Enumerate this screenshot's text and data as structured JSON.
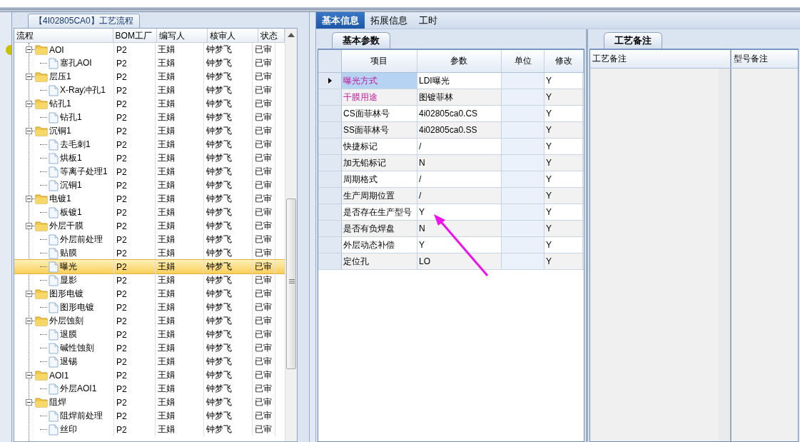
{
  "flow_panel": {
    "title": "【4I02805CA0】工艺流程",
    "columns": [
      "流程",
      "BOM工厂",
      "编写人",
      "核审人",
      "状态"
    ],
    "tree": [
      {
        "name": "AOI",
        "bom": "P2",
        "writer": "王娟",
        "reviewer": "钟梦飞",
        "status": "已审",
        "selected": false,
        "expanded": true,
        "children": [
          {
            "name": "塞孔AOI",
            "bom": "P2",
            "writer": "王娟",
            "reviewer": "钟梦飞",
            "status": "已审",
            "selected": false
          }
        ]
      },
      {
        "name": "层压1",
        "bom": "P2",
        "writer": "王娟",
        "reviewer": "钟梦飞",
        "status": "已审",
        "selected": false,
        "expanded": true,
        "children": [
          {
            "name": "X-Ray冲孔1",
            "bom": "P2",
            "writer": "王娟",
            "reviewer": "钟梦飞",
            "status": "已审",
            "selected": false
          }
        ]
      },
      {
        "name": "钻孔1",
        "bom": "P2",
        "writer": "王娟",
        "reviewer": "钟梦飞",
        "status": "已审",
        "selected": false,
        "expanded": true,
        "children": [
          {
            "name": "钻孔1",
            "bom": "P2",
            "writer": "王娟",
            "reviewer": "钟梦飞",
            "status": "已审",
            "selected": false
          }
        ]
      },
      {
        "name": "沉铜1",
        "bom": "P2",
        "writer": "王娟",
        "reviewer": "钟梦飞",
        "status": "已审",
        "selected": false,
        "expanded": true,
        "children": [
          {
            "name": "去毛刺1",
            "bom": "P2",
            "writer": "王娟",
            "reviewer": "钟梦飞",
            "status": "已审",
            "selected": false
          },
          {
            "name": "烘板1",
            "bom": "P2",
            "writer": "王娟",
            "reviewer": "钟梦飞",
            "status": "已审",
            "selected": false
          },
          {
            "name": "等离子处理1",
            "bom": "P2",
            "writer": "王娟",
            "reviewer": "钟梦飞",
            "status": "已审",
            "selected": false
          },
          {
            "name": "沉铜1",
            "bom": "P2",
            "writer": "王娟",
            "reviewer": "钟梦飞",
            "status": "已审",
            "selected": false
          }
        ]
      },
      {
        "name": "电镀1",
        "bom": "P2",
        "writer": "王娟",
        "reviewer": "钟梦飞",
        "status": "已审",
        "selected": false,
        "expanded": true,
        "children": [
          {
            "name": "板镀1",
            "bom": "P2",
            "writer": "王娟",
            "reviewer": "钟梦飞",
            "status": "已审",
            "selected": false
          }
        ]
      },
      {
        "name": "外层干膜",
        "bom": "P2",
        "writer": "王娟",
        "reviewer": "钟梦飞",
        "status": "已审",
        "selected": false,
        "expanded": true,
        "children": [
          {
            "name": "外层前处理",
            "bom": "P2",
            "writer": "王娟",
            "reviewer": "钟梦飞",
            "status": "已审",
            "selected": false
          },
          {
            "name": "贴膜",
            "bom": "P2",
            "writer": "王娟",
            "reviewer": "钟梦飞",
            "status": "已审",
            "selected": false
          },
          {
            "name": "曝光",
            "bom": "P2",
            "writer": "王娟",
            "reviewer": "钟梦飞",
            "status": "已审",
            "selected": true
          },
          {
            "name": "显影",
            "bom": "P2",
            "writer": "王娟",
            "reviewer": "钟梦飞",
            "status": "已审",
            "selected": false
          }
        ]
      },
      {
        "name": "图形电镀",
        "bom": "P2",
        "writer": "王娟",
        "reviewer": "钟梦飞",
        "status": "已审",
        "selected": false,
        "expanded": true,
        "children": [
          {
            "name": "图形电镀",
            "bom": "P2",
            "writer": "王娟",
            "reviewer": "钟梦飞",
            "status": "已审",
            "selected": false
          }
        ]
      },
      {
        "name": "外层蚀刻",
        "bom": "P2",
        "writer": "王娟",
        "reviewer": "钟梦飞",
        "status": "已审",
        "selected": false,
        "expanded": true,
        "children": [
          {
            "name": "退膜",
            "bom": "P2",
            "writer": "王娟",
            "reviewer": "钟梦飞",
            "status": "已审",
            "selected": false
          },
          {
            "name": "碱性蚀刻",
            "bom": "P2",
            "writer": "王娟",
            "reviewer": "钟梦飞",
            "status": "已审",
            "selected": false
          },
          {
            "name": "退锡",
            "bom": "P2",
            "writer": "王娟",
            "reviewer": "钟梦飞",
            "status": "已审",
            "selected": false
          }
        ]
      },
      {
        "name": "AOI1",
        "bom": "P2",
        "writer": "王娟",
        "reviewer": "钟梦飞",
        "status": "已审",
        "selected": false,
        "expanded": true,
        "children": [
          {
            "name": "外层AOI1",
            "bom": "P2",
            "writer": "王娟",
            "reviewer": "钟梦飞",
            "status": "已审",
            "selected": false
          }
        ]
      },
      {
        "name": "阻焊",
        "bom": "P2",
        "writer": "王娟",
        "reviewer": "钟梦飞",
        "status": "已审",
        "selected": false,
        "expanded": true,
        "children": [
          {
            "name": "阻焊前处理",
            "bom": "P2",
            "writer": "王娟",
            "reviewer": "钟梦飞",
            "status": "已审",
            "selected": false
          },
          {
            "name": "丝印",
            "bom": "P2",
            "writer": "王娟",
            "reviewer": "钟梦飞",
            "status": "已审",
            "selected": false
          }
        ]
      }
    ]
  },
  "tabs": [
    {
      "label": "基本信息",
      "selected": true
    },
    {
      "label": "拓展信息",
      "selected": false
    },
    {
      "label": "工时",
      "selected": false
    }
  ],
  "params_panel": {
    "tab": "基本参数",
    "columns": [
      "项目",
      "参数",
      "单位",
      "修改"
    ],
    "rows": [
      {
        "item": "曝光方式",
        "value": "LDI曝光",
        "modify": "Y",
        "highlighted": true,
        "selected": true
      },
      {
        "item": "干膜用途",
        "value": "图镀菲林",
        "modify": "Y",
        "highlighted": true,
        "selected": false
      },
      {
        "item": "CS面菲林号",
        "value": "4i02805ca0.CS",
        "modify": "Y",
        "highlighted": false,
        "selected": false
      },
      {
        "item": "SS面菲林号",
        "value": "4i02805ca0.SS",
        "modify": "Y",
        "highlighted": false,
        "selected": false
      },
      {
        "item": "快捷标记",
        "value": "/",
        "modify": "Y",
        "highlighted": false,
        "selected": false
      },
      {
        "item": "加无铅标记",
        "value": "N",
        "modify": "Y",
        "highlighted": false,
        "selected": false
      },
      {
        "item": "周期格式",
        "value": "/",
        "modify": "Y",
        "highlighted": false,
        "selected": false
      },
      {
        "item": "生产周期位置",
        "value": "/",
        "modify": "Y",
        "highlighted": false,
        "selected": false
      },
      {
        "item": "是否存在生产型号",
        "value": "Y",
        "modify": "Y",
        "highlighted": false,
        "selected": false
      },
      {
        "item": "是否有负焊盘",
        "value": "N",
        "modify": "Y",
        "highlighted": false,
        "selected": false
      },
      {
        "item": "外层动态补偿",
        "value": "Y",
        "modify": "Y",
        "highlighted": false,
        "selected": false
      },
      {
        "item": "定位孔",
        "value": "LO",
        "modify": "Y",
        "highlighted": false,
        "selected": false
      }
    ]
  },
  "notes_panel": {
    "tab": "工艺备注",
    "columns": [
      "工艺备注",
      "型号备注"
    ]
  }
}
